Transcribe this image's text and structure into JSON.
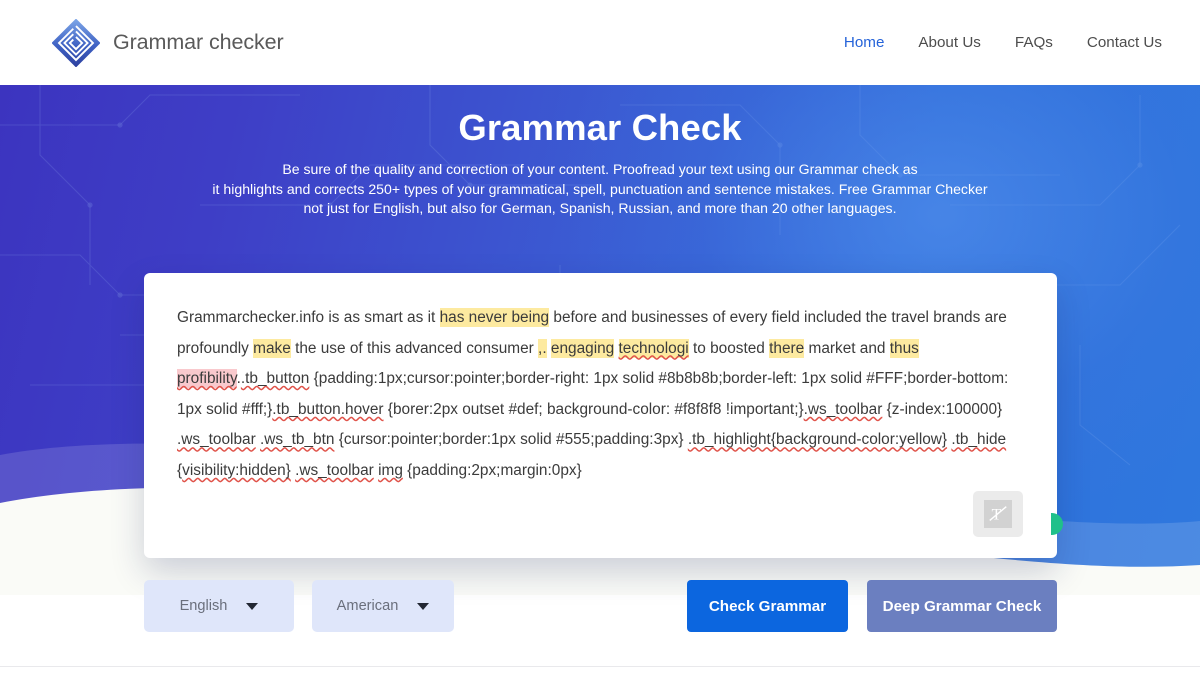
{
  "header": {
    "brand_name": "Grammar checker",
    "logo_icon": "diamond-spiral-logo-icon",
    "nav": [
      {
        "label": "Home",
        "active": true
      },
      {
        "label": "About Us",
        "active": false
      },
      {
        "label": "FAQs",
        "active": false
      },
      {
        "label": "Contact Us",
        "active": false
      }
    ],
    "accent_color": "#2563d9"
  },
  "hero": {
    "title": "Grammar Check",
    "subtitle_lines": [
      "Be sure of the quality and correction of your content. Proofread your text using our Grammar check as",
      "it highlights and corrects 250+ types of your grammatical, spell, punctuation and sentence mistakes. Free Grammar Checker",
      "not just for English, but also for German, Spanish, Russian, and more than 20 other languages."
    ],
    "background_gradient_start": "#3c34bf",
    "background_gradient_end": "#2f78de"
  },
  "editor": {
    "tool_button_icon": "strikethrough-text-icon",
    "side_tab_icon": "green-handle-tab",
    "side_tab_color": "#1fc08a",
    "highlight_yellow": "#fdeaa0",
    "highlight_pink": "#f9c9cd",
    "spelling_underline_color": "#e0534a",
    "segments": [
      {
        "text": "Grammarchecker.info is as smart as it ",
        "style": "plain"
      },
      {
        "text": "has never being",
        "style": "highlight-yellow"
      },
      {
        "text": " before and businesses of every field included the travel brands are profoundly ",
        "style": "plain"
      },
      {
        "text": "make",
        "style": "highlight-yellow"
      },
      {
        "text": " the use of this advanced consumer ",
        "style": "plain"
      },
      {
        "text": ",.",
        "style": "highlight-yellow"
      },
      {
        "text": " ",
        "style": "plain"
      },
      {
        "text": "engaging",
        "style": "highlight-yellow"
      },
      {
        "text": " ",
        "style": "plain"
      },
      {
        "text": "technologi",
        "style": "highlight-yellow-misspelled"
      },
      {
        "text": " to boosted ",
        "style": "plain"
      },
      {
        "text": "there",
        "style": "highlight-yellow"
      },
      {
        "text": " market and ",
        "style": "plain"
      },
      {
        "text": "thus",
        "style": "highlight-yellow"
      },
      {
        "text": " ",
        "style": "plain"
      },
      {
        "text": "profibility",
        "style": "highlight-pink-misspelled"
      },
      {
        "text": ".",
        "style": "plain"
      },
      {
        "text": ".tb_button",
        "style": "misspelled"
      },
      {
        "text": " {padding:1px;cursor:pointer;border-right: 1px solid #8b8b8b;border-left: 1px solid #FFF;border-bottom: 1px solid #fff;}",
        "style": "plain"
      },
      {
        "text": ".tb_button.hover",
        "style": "misspelled"
      },
      {
        "text": " {borer:2px outset #def; background-color: #f8f8f8 !important;}",
        "style": "plain"
      },
      {
        "text": ".ws_toolbar",
        "style": "misspelled"
      },
      {
        "text": " {z-index:100000} ",
        "style": "plain"
      },
      {
        "text": ".ws_toolbar",
        "style": "misspelled"
      },
      {
        "text": " ",
        "style": "plain"
      },
      {
        "text": ".ws_tb_btn",
        "style": "misspelled"
      },
      {
        "text": " {cursor:pointer;border:1px solid #555;padding:3px} ",
        "style": "plain"
      },
      {
        "text": ".tb_highlight{background-color:yellow}",
        "style": "misspelled"
      },
      {
        "text": " ",
        "style": "plain"
      },
      {
        "text": ".tb_hide",
        "style": "misspelled"
      },
      {
        "text": " {",
        "style": "plain"
      },
      {
        "text": "visibility:hidden}",
        "style": "misspelled"
      },
      {
        "text": " ",
        "style": "plain"
      },
      {
        "text": ".ws_toolbar",
        "style": "misspelled"
      },
      {
        "text": " ",
        "style": "plain"
      },
      {
        "text": "img",
        "style": "misspelled"
      },
      {
        "text": " {padding:2px;margin:0px}",
        "style": "plain"
      }
    ]
  },
  "controls": {
    "language_select": {
      "value": "English",
      "caret_icon": "chevron-down-icon"
    },
    "variant_select": {
      "value": "American",
      "caret_icon": "chevron-down-icon"
    },
    "check_button": {
      "label": "Check Grammar",
      "color": "#0c66df"
    },
    "deep_check_button": {
      "label": "Deep Grammar Check",
      "color": "#6b7fc0"
    }
  }
}
